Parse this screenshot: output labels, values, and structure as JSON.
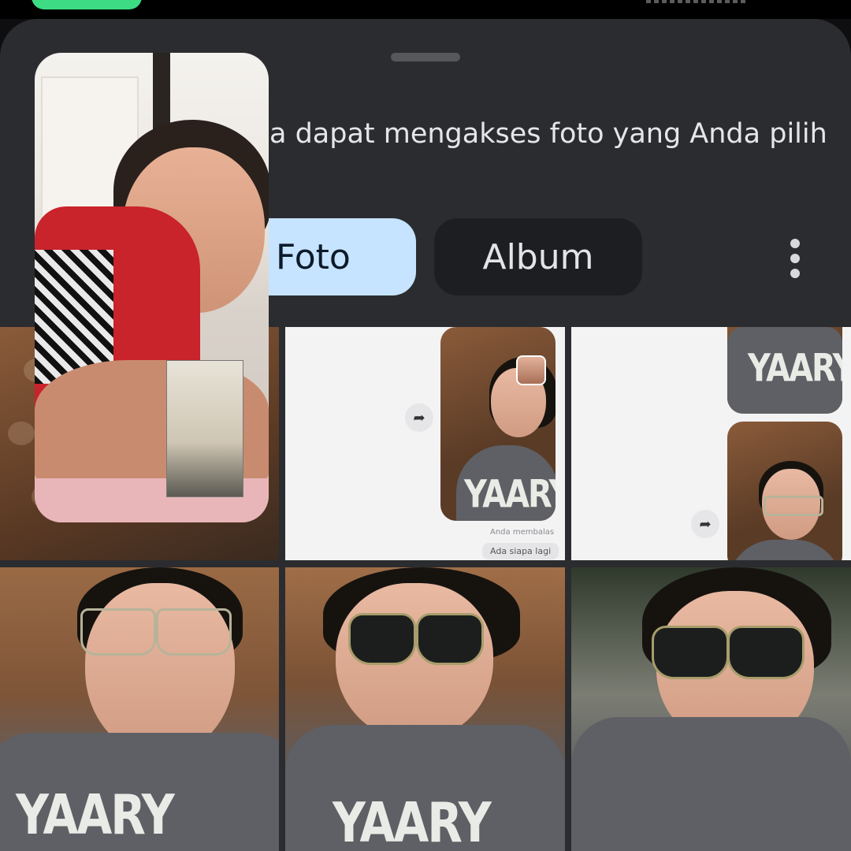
{
  "sheet": {
    "header_text": "a dapat mengakses foto yang Anda pilih"
  },
  "tabs": {
    "foto": "Foto",
    "album": "Album"
  },
  "grid": {
    "chat_caption": "Anda membalas",
    "chat_bubble": "Ada siapa lagi",
    "shirt_text": "YAARY"
  },
  "colors": {
    "sheet_bg": "#2b2c2f",
    "active_tab": "#c6e4ff",
    "inactive_tab": "#1d1e21",
    "status_pill": "#3ddc84"
  },
  "icons": {
    "more": "more-vert-icon",
    "share": "share-icon"
  }
}
